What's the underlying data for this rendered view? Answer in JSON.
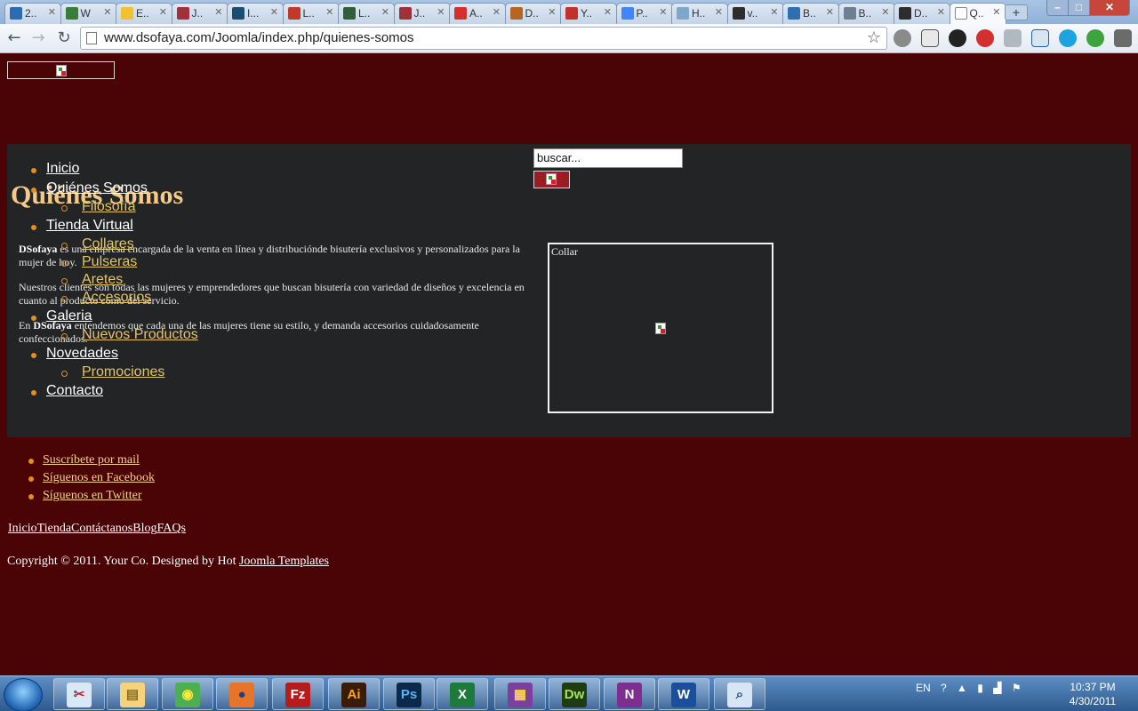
{
  "browser": {
    "tabs": [
      {
        "label": "2..",
        "icon": "codeproject-icon",
        "color": "#2b6cb0"
      },
      {
        "label": "W",
        "icon": "web-app-icon",
        "color": "#3a7d3a"
      },
      {
        "label": "E..",
        "icon": "shield-icon",
        "color": "#f2c12e"
      },
      {
        "label": "J..",
        "icon": "joomla-icon",
        "color": "#a0303a"
      },
      {
        "label": "I...",
        "icon": "hacker-news-icon",
        "color": "#1d4d6e"
      },
      {
        "label": "L..",
        "icon": "c-icon",
        "color": "#c0392b"
      },
      {
        "label": "L..",
        "icon": "lantern-icon",
        "color": "#2f5f3a"
      },
      {
        "label": "J..",
        "icon": "joomla-icon",
        "color": "#a0303a"
      },
      {
        "label": "A..",
        "icon": "adobe-icon",
        "color": "#d32f2f"
      },
      {
        "label": "D..",
        "icon": "fb-icon",
        "color": "#b5651d"
      },
      {
        "label": "Y..",
        "icon": "youtube-icon",
        "color": "#c4302b"
      },
      {
        "label": "P..",
        "icon": "google-icon",
        "color": "#4285f4"
      },
      {
        "label": "H..",
        "icon": "spiral-icon",
        "color": "#7fa7c9"
      },
      {
        "label": "v..",
        "icon": "joomla-icon",
        "color": "#2d2d2d"
      },
      {
        "label": "B..",
        "icon": "globe-icon",
        "color": "#2f6fb0"
      },
      {
        "label": "B..",
        "icon": "gear-globe-icon",
        "color": "#6d7f93"
      },
      {
        "label": "D..",
        "icon": "joomla-icon",
        "color": "#2d2d2d"
      },
      {
        "label": "Q..",
        "icon": "page-icon",
        "color": "#ffffff"
      }
    ],
    "url": "www.dsofaya.com/Joomla/index.php/quienes-somos"
  },
  "site": {
    "search": {
      "value": "buscar..."
    },
    "page_title": "Quiénes Somos",
    "menu": [
      {
        "label": "Inicio",
        "level": 0
      },
      {
        "label": "Quiénes Somos",
        "level": 0
      },
      {
        "label": "Filosofía",
        "level": 1
      },
      {
        "label": "Tienda Virtual",
        "level": 0
      },
      {
        "label": "Collares",
        "level": 1
      },
      {
        "label": "Pulseras",
        "level": 1
      },
      {
        "label": "Aretes",
        "level": 1
      },
      {
        "label": "Accesorios",
        "level": 1
      },
      {
        "label": "Galeria",
        "level": 0
      },
      {
        "label": "Nuevos Productos",
        "level": 1
      },
      {
        "label": "Novedades",
        "level": 0
      },
      {
        "label": "Promociones",
        "level": 1
      },
      {
        "label": "Contacto",
        "level": 0
      }
    ],
    "article": {
      "p1_brand": "DSofaya",
      "p1_rest": " es una empresa encargada de la venta en línea y distribuciónde bisutería exclusivos y personalizados para la mujer de hoy.",
      "p2": "Nuestros clientes son todas las mujeres y emprendedores que buscan bisutería con variedad de diseños y excelencia en cuanto al producto como del servicio.",
      "p3_pre": "En ",
      "p3_brand": "DSofaya",
      "p3_rest": " entendemos que cada una de las mujeres tiene su estilo, y demanda accesorios cuidadosamente confeccionados."
    },
    "collar_label": "Collar",
    "social": [
      "Suscríbete por mail",
      "Síguenos en Facebook",
      "Síguenos en Twitter"
    ],
    "footer_nav": [
      "Inicio",
      "Tienda",
      "Contáctanos",
      "Blog",
      "FAQs"
    ],
    "copyright_text": "Copyright © 2011. Your Co. Designed by Hot ",
    "copyright_link": "Joomla Templates"
  },
  "taskbar": {
    "apps": [
      {
        "name": "snipping-tool",
        "glyph": "✂",
        "bg": "#d9e8f7",
        "fg": "#c62828"
      },
      {
        "name": "explorer",
        "glyph": "▤",
        "bg": "#f4d37a",
        "fg": "#8a6d1f"
      },
      {
        "name": "chrome",
        "glyph": "◉",
        "bg": "#4caf50",
        "fg": "#ffeb3b"
      },
      {
        "name": "firefox",
        "glyph": "●",
        "bg": "#e8742a",
        "fg": "#1e3f8a"
      },
      {
        "name": "filezilla",
        "glyph": "Fz",
        "bg": "#b71c1c",
        "fg": "#ffffff"
      },
      {
        "name": "illustrator",
        "glyph": "Ai",
        "bg": "#3b1c06",
        "fg": "#f5a623"
      },
      {
        "name": "photoshop",
        "glyph": "Ps",
        "bg": "#0b2a4a",
        "fg": "#5fb0f0"
      },
      {
        "name": "excel",
        "glyph": "X",
        "bg": "#1e7a3a",
        "fg": "#ffffff"
      },
      {
        "name": "winrar",
        "glyph": "▦",
        "bg": "#7b3f9e",
        "fg": "#ffd54f"
      },
      {
        "name": "dreamweaver",
        "glyph": "Dw",
        "bg": "#1f3b10",
        "fg": "#a8e063"
      },
      {
        "name": "onenote",
        "glyph": "N",
        "bg": "#7e2e8e",
        "fg": "#ffffff"
      },
      {
        "name": "word",
        "glyph": "W",
        "bg": "#1b4f9c",
        "fg": "#ffffff"
      },
      {
        "name": "search-tool",
        "glyph": "⌕",
        "bg": "#d6e6f5",
        "fg": "#2c4f7c"
      }
    ],
    "tray_lang": "EN",
    "clock_time": "10:37 PM",
    "clock_date": "4/30/2011"
  }
}
